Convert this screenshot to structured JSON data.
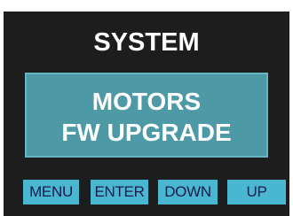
{
  "screen": {
    "title": "SYSTEM",
    "selected_item": {
      "line1": "MOTORS",
      "line2": "FW UPGRADE"
    }
  },
  "softkeys": {
    "menu": "MENU",
    "enter": "ENTER",
    "down": "DOWN",
    "up": "UP"
  },
  "colors": {
    "screen_background": "#1d1d1d",
    "selection_fill": "#4d9aa6",
    "softkey_fill": "#4ab7d1",
    "title_text": "#ffffff"
  }
}
